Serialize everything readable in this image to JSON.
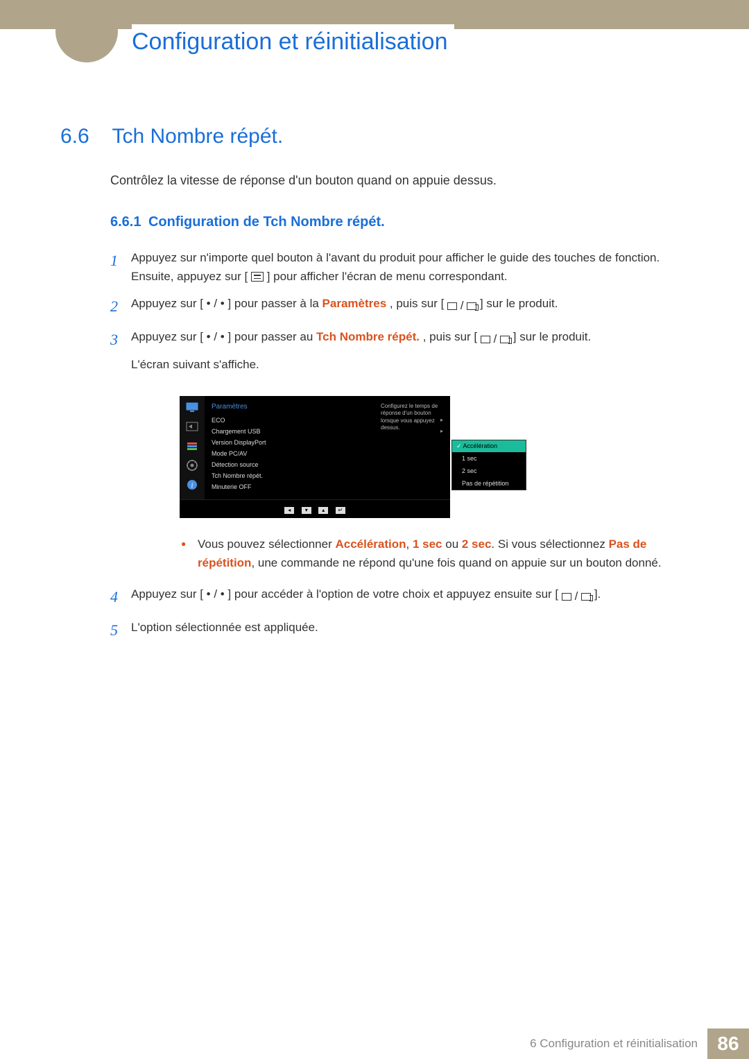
{
  "header": {
    "chapter_title": "Configuration et réinitialisation"
  },
  "section": {
    "number": "6.6",
    "title": "Tch Nombre répét."
  },
  "intro": "Contrôlez la vitesse de réponse d'un bouton quand on appuie dessus.",
  "subsection": {
    "number": "6.6.1",
    "title": "Configuration de Tch Nombre répét."
  },
  "steps": {
    "s1": {
      "num": "1",
      "text_a": "Appuyez sur n'importe quel bouton à l'avant du produit pour afficher le guide des touches de fonction. Ensuite, appuyez sur [",
      "text_b": "] pour afficher l'écran de menu correspondant."
    },
    "s2": {
      "num": "2",
      "text_a": "Appuyez sur [ • / • ] pour passer à la ",
      "hl": "Paramètres",
      "text_b": ", puis sur [",
      "text_c": "] sur le produit."
    },
    "s3": {
      "num": "3",
      "text_a": "Appuyez sur [ • / • ] pour passer au ",
      "hl": "Tch Nombre répét.",
      "text_b": ", puis sur [",
      "text_c": "] sur le produit.",
      "after": "L'écran suivant s'affiche."
    },
    "s4": {
      "num": "4",
      "text_a": "Appuyez sur [ • / • ] pour accéder à l'option de votre choix et appuyez ensuite sur [",
      "text_b": "]."
    },
    "s5": {
      "num": "5",
      "text": "L'option sélectionnée est appliquée."
    }
  },
  "osd": {
    "title": "Paramètres",
    "items": [
      "ECO",
      "Chargement USB",
      "Version DisplayPort",
      "Mode PC/AV",
      "Détection source",
      "Tch Nombre répét.",
      "Minuterie OFF"
    ],
    "popup": {
      "selected": "Accélération",
      "options": [
        "1 sec",
        "2 sec",
        "Pas de répétition"
      ]
    },
    "help": "Configurez le temps de réponse d'un bouton lorsque vous appuyez dessus."
  },
  "note": {
    "a": "Vous pouvez sélectionner ",
    "hl1": "Accélération",
    "sep1": ", ",
    "hl2": "1 sec",
    "sep2": " ou ",
    "hl3": "2 sec",
    "sep3": ". Si vous sélectionnez ",
    "hl4": "Pas de répétition",
    "b": ", une commande ne répond qu'une fois quand on appuie sur un bouton donné."
  },
  "footer": {
    "text": "6 Configuration et réinitialisation",
    "page": "86"
  }
}
